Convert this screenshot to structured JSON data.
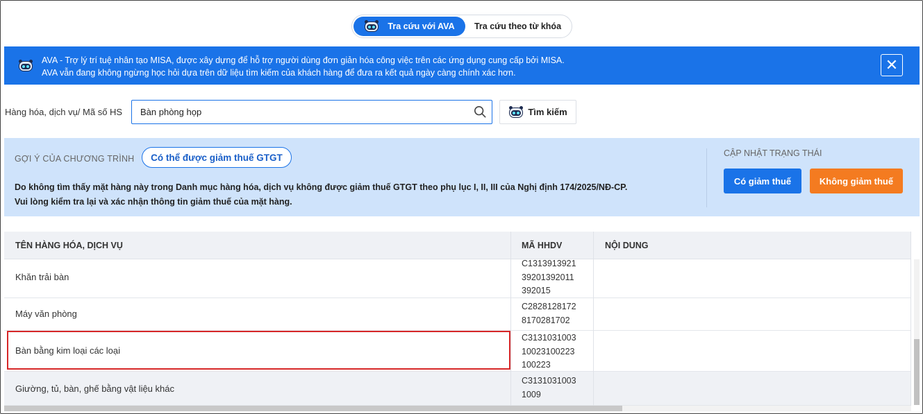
{
  "toggle": {
    "active_label": "Tra cứu với AVA",
    "inactive_label": "Tra cứu theo từ khóa"
  },
  "banner": {
    "line1": "AVA - Trợ lý trí tuệ nhân tạo MISA, được xây dựng để hỗ trợ người dùng đơn giản hóa công việc trên các ứng dụng cung cấp bởi MISA.",
    "line2": "AVA vẫn đang không ngừng học hỏi dựa trên dữ liệu tìm kiếm của khách hàng để đưa ra kết quả ngày càng chính xác hơn.",
    "close_glyph": "✕"
  },
  "search": {
    "label": "Hàng hóa, dịch vụ/ Mã số HS",
    "value": "Bàn phòng họp",
    "button_label": "Tìm kiếm"
  },
  "suggestion": {
    "heading": "GỢI Ý CỦA CHƯƠNG TRÌNH",
    "pill_label": "Có thể được giảm thuế GTGT",
    "message_line1": "Do không tìm thấy mặt hàng này trong Danh mục hàng hóa, dịch vụ không được giảm thuế GTGT theo phụ lục I, II, III của Nghị định 174/2025/NĐ-CP.",
    "message_line2": "Vui lòng kiểm tra lại và xác nhận thông tin giảm thuế của mặt hàng.",
    "status_heading": "CẬP NHẬT TRẠNG THÁI",
    "btn_yes": "Có giảm thuế",
    "btn_no": "Không giảm thuế"
  },
  "table": {
    "columns": [
      "TÊN HÀNG HÓA, DỊCH VỤ",
      "MÃ HHDV",
      "NỘI DUNG"
    ],
    "rows": [
      {
        "name": "Khăn trải bàn",
        "code_lines": [
          "C1313913921",
          "39201392011",
          "392015"
        ],
        "content": ""
      },
      {
        "name": "Máy văn phòng",
        "code_lines": [
          "C2828128172",
          "8170281702"
        ],
        "content": ""
      },
      {
        "name": "Bàn bằng kim loại các loại",
        "code_lines": [
          "C3131031003",
          "10023100223",
          "100223"
        ],
        "content": ""
      },
      {
        "name": "Giường, tủ, bàn, ghế bằng vật liệu khác",
        "code_lines": [
          "C3131031003",
          "1009"
        ],
        "content": ""
      }
    ]
  },
  "colors": {
    "primary": "#1a73e8",
    "orange": "#f47b20",
    "panel": "#cfe3fb",
    "highlight": "#d62728"
  }
}
